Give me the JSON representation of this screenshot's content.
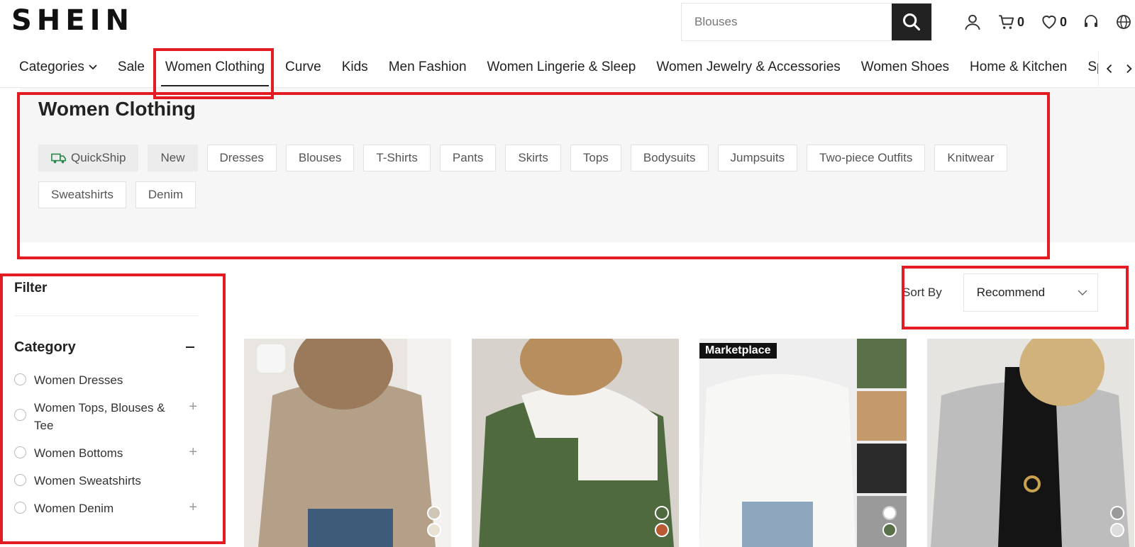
{
  "header": {
    "logo": "SHEIN",
    "search_placeholder": "Blouses",
    "cart_count": "0",
    "wishlist_count": "0"
  },
  "nav": {
    "items": [
      "Categories",
      "Sale",
      "Women Clothing",
      "Curve",
      "Kids",
      "Men Fashion",
      "Women Lingerie & Sleep",
      "Women Jewelry & Accessories",
      "Women Shoes",
      "Home & Kitchen",
      "Spo"
    ],
    "active_index": 2
  },
  "category_panel": {
    "title": "Women Clothing",
    "chips": [
      "QuickShip",
      "New",
      "Dresses",
      "Blouses",
      "T-Shirts",
      "Pants",
      "Skirts",
      "Tops",
      "Bodysuits",
      "Jumpsuits",
      "Two-piece Outfits",
      "Knitwear",
      "Sweatshirts",
      "Denim"
    ]
  },
  "filter": {
    "title": "Filter",
    "category_label": "Category",
    "items": [
      {
        "label": "Women Dresses",
        "expandable": false
      },
      {
        "label": "Women Tops, Blouses & Tee",
        "expandable": true
      },
      {
        "label": "Women Bottoms",
        "expandable": true
      },
      {
        "label": "Women Sweatshirts",
        "expandable": false
      },
      {
        "label": "Women Denim",
        "expandable": true
      }
    ]
  },
  "sort": {
    "label": "Sort By",
    "value": "Recommend"
  },
  "products": [
    {
      "badge": ""
    },
    {
      "badge": ""
    },
    {
      "badge": "Marketplace"
    },
    {
      "badge": ""
    }
  ],
  "colors": {
    "highlight": "#e31b23",
    "quickship_green": "#2d8a4e",
    "panel_bg": "#f6f6f6"
  }
}
